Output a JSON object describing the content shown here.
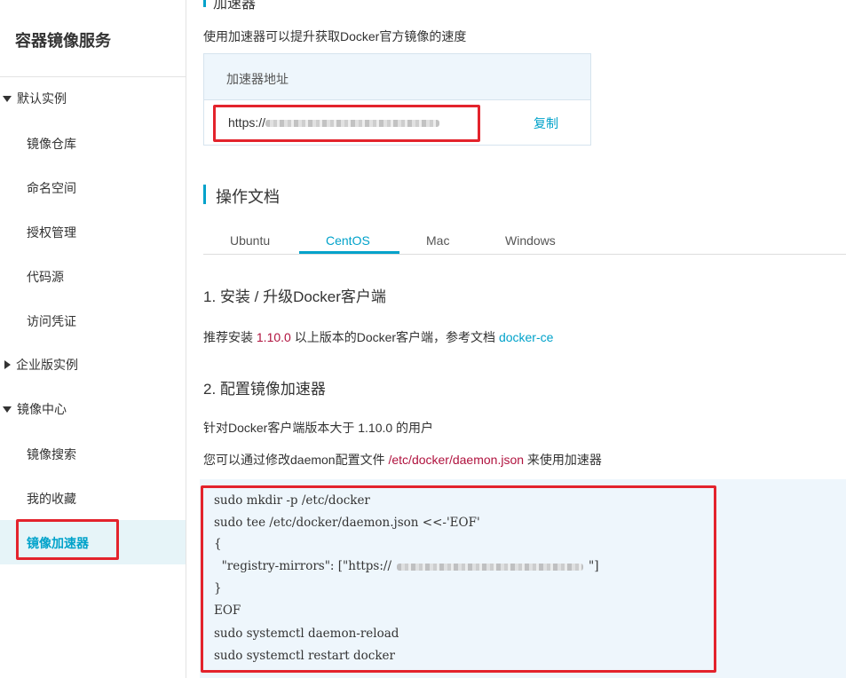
{
  "sidebar": {
    "title": "容器镜像服务",
    "groups": [
      {
        "label": "默认实例",
        "expanded": true
      },
      {
        "label": "企业版实例",
        "expanded": false
      },
      {
        "label": "镜像中心",
        "expanded": true
      }
    ],
    "items": [
      {
        "label": "镜像仓库"
      },
      {
        "label": "命名空间"
      },
      {
        "label": "授权管理"
      },
      {
        "label": "代码源"
      },
      {
        "label": "访问凭证"
      },
      {
        "label": "镜像搜索"
      },
      {
        "label": "我的收藏"
      },
      {
        "label": "镜像加速器",
        "active": true
      }
    ]
  },
  "accelerator": {
    "section_title_cut": "加速器",
    "description": "使用加速器可以提升获取Docker官方镜像的速度",
    "table_header": "加速器地址",
    "url_prefix": "https://",
    "copy_label": "复制"
  },
  "docs": {
    "title": "操作文档",
    "tabs": [
      {
        "label": "Ubuntu"
      },
      {
        "label": "CentOS",
        "active": true
      },
      {
        "label": "Mac"
      },
      {
        "label": "Windows"
      }
    ],
    "step1": {
      "heading": "1. 安装 / 升级Docker客户端",
      "text_before": "推荐安装 ",
      "version": "1.10.0",
      "text_middle": " 以上版本的Docker客户端，参考文档 ",
      "link": "docker-ce"
    },
    "step2": {
      "heading": "2. 配置镜像加速器",
      "line1": "针对Docker客户端版本大于 1.10.0 的用户",
      "line2_before": "您可以通过修改daemon配置文件 ",
      "path": "/etc/docker/daemon.json",
      "line2_after": " 来使用加速器"
    },
    "code": [
      "sudo mkdir -p /etc/docker",
      "sudo tee /etc/docker/daemon.json <<-'EOF'",
      "{",
      "  \"registry-mirrors\": [\"https://",
      "}",
      "EOF",
      "sudo systemctl daemon-reload",
      "sudo systemctl restart docker"
    ],
    "code_mirror_suffix": "\"]"
  },
  "colors": {
    "accent": "#00a2ca",
    "highlight_red": "#e3232c",
    "maroon": "#b0123e",
    "code_bg": "#eef6fc"
  }
}
